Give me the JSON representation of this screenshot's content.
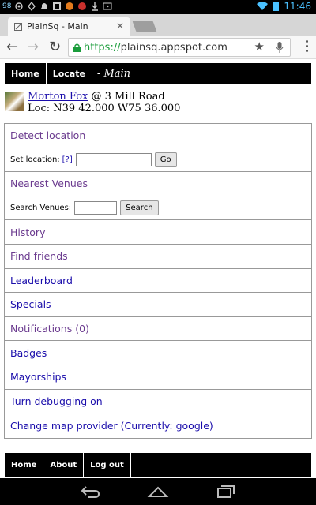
{
  "status_bar": {
    "left_text": "98",
    "time": "11:46",
    "icons": [
      "android-icon",
      "location-icon",
      "bell-icon",
      "settings-icon",
      "warning-icon",
      "notification-icon",
      "download-icon",
      "play-icon"
    ]
  },
  "browser": {
    "tab_title": "PlainSq - Main",
    "url_scheme": "https://",
    "url_host": "plainsq.",
    "url_domain": "appspot.com"
  },
  "nav": {
    "home": "Home",
    "locate": "Locate",
    "title": "- Main"
  },
  "user": {
    "name": "Morton Fox",
    "at_text": "@ 3 Mill Road",
    "loc_text": "Loc: N39 42.000 W75 36.000"
  },
  "menu": {
    "detect_location": "Detect location",
    "set_location_label": "Set location:",
    "help_link": "[?]",
    "go_button": "Go",
    "nearest_venues": "Nearest Venues",
    "search_venues_label": "Search Venues:",
    "search_button": "Search",
    "history": "History",
    "find_friends": "Find friends",
    "leaderboard": "Leaderboard",
    "specials": "Specials",
    "notifications": "Notifications (0)",
    "badges": "Badges",
    "mayorships": "Mayorships",
    "turn_debugging": "Turn debugging on",
    "change_map": "Change map provider (Currently: google)"
  },
  "footer": {
    "home": "Home",
    "about": "About",
    "logout": "Log out"
  },
  "colors": {
    "visited_link": "#6b3b8f",
    "unvisited_link": "#1a0dab",
    "secure_green": "#1a9c3b"
  }
}
